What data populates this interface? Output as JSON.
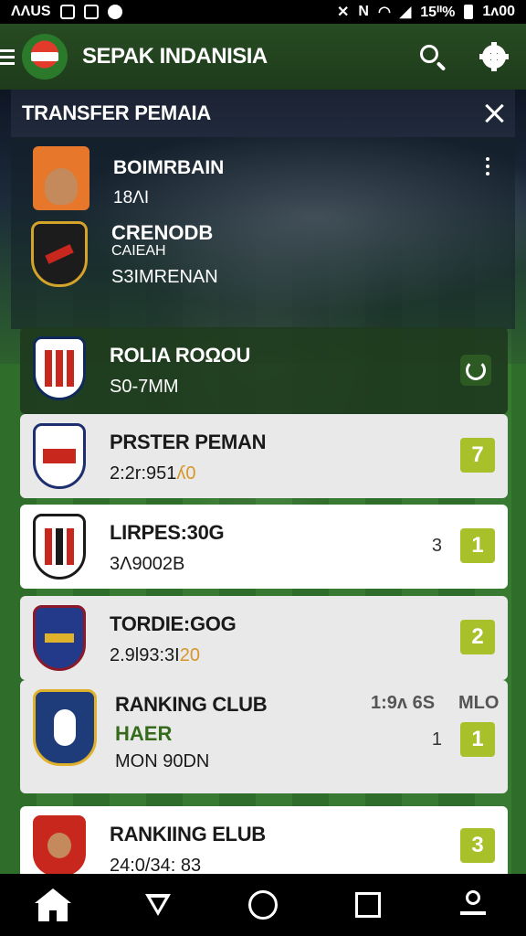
{
  "status_bar": {
    "left_text": "ΛΛUS",
    "time": "1ᴧ00",
    "battery": "15ᐦ%",
    "icons": [
      "notification-icon",
      "image-icon",
      "cloud-icon",
      "mute-icon",
      "no-signal-icon",
      "wifi-icon",
      "cellular-icon",
      "battery-icon"
    ]
  },
  "header": {
    "title": "SEPAK INDANISIA",
    "logo_icon": "club-logo-icon",
    "actions": [
      "search-icon",
      "gear-icon"
    ]
  },
  "panel": {
    "title": "TRANSFER PEMAIA",
    "close_icon": "close-icon",
    "top_player": {
      "name": "BOIMRBAIN",
      "detail": "18ΛI",
      "avatar_icon": "player-avatar-icon"
    },
    "club_entry": {
      "name": "CRENODB",
      "overlay": "CAIEAH",
      "detail": "S3IMRENAN",
      "crest_icon": "club-crest-icon"
    }
  },
  "rows": [
    {
      "name": "ROLIA ROΩOU",
      "sub": "S0-7MM",
      "action_icon": "refresh-icon",
      "selected": true
    },
    {
      "name": "PRSTER PEMAN",
      "sub": "2:2r:951",
      "sub_accent": "ʎ0",
      "rank": "7"
    },
    {
      "name": "LIRPES:30G",
      "sub": "3Λ9002B",
      "aux": "3",
      "rank": "1"
    },
    {
      "name": "TORDIE:GOG",
      "sub": "2.9l93:3I",
      "sub_accent": "20",
      "rank": "2"
    },
    {
      "name": "RANKING CLUB",
      "highlight": "HAER",
      "sub": "MON 90DN",
      "aux_left": "1:9ᴧ 6S",
      "aux_right": "MLO",
      "aux": "1",
      "rank": "1"
    },
    {
      "name": "RANKIING ELUB",
      "sub": "24:0/34: 83",
      "rank": "3"
    }
  ],
  "colors": {
    "header_bg": "#1e3c1b",
    "panel_bar": "#1b2233",
    "badge": "#a8c02a",
    "selected_row": "#1e3a1e",
    "accent_text": "#d8962a",
    "highlight_text": "#356b1a"
  },
  "nav": [
    "home-icon",
    "back-icon",
    "circle-icon",
    "square-icon",
    "profile-icon"
  ]
}
